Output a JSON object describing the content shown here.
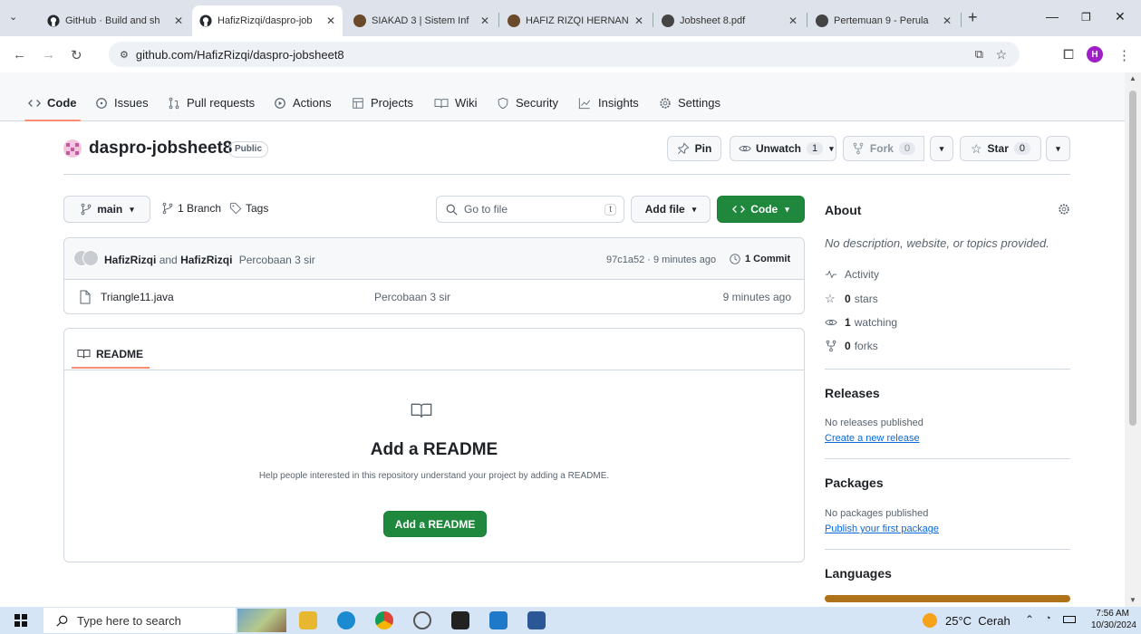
{
  "browser": {
    "tabs": [
      {
        "title": "GitHub · Build and sh",
        "icon": "github-icon"
      },
      {
        "title": "HafizRizqi/daspro-job",
        "icon": "github-icon",
        "active": true
      },
      {
        "title": "SIAKAD 3 | Sistem Inf",
        "icon": "polinema-icon"
      },
      {
        "title": "HAFIZ RIZQI HERNAN",
        "icon": "polinema-icon"
      },
      {
        "title": "Jobsheet 8.pdf",
        "icon": "globe-icon"
      },
      {
        "title": "Pertemuan 9 - Perula",
        "icon": "globe-icon"
      }
    ],
    "new_tab": "+",
    "url": "github.com/HafizRizqi/daspro-jobsheet8",
    "profile_initial": "H"
  },
  "repo_nav": {
    "tabs": [
      "Code",
      "Issues",
      "Pull requests",
      "Actions",
      "Projects",
      "Wiki",
      "Security",
      "Insights",
      "Settings"
    ]
  },
  "repo": {
    "name": "daspro-jobsheet8",
    "visibility": "Public",
    "pin_label": "Pin",
    "unwatch_label": "Unwatch",
    "watch_count": "1",
    "fork_label": "Fork",
    "fork_count": "0",
    "star_label": "Star",
    "star_count": "0"
  },
  "toolbar": {
    "branch": "main",
    "branch_count": "1 Branch",
    "tags": "Tags",
    "search_placeholder": "Go to file",
    "search_key": "t",
    "add_file": "Add file",
    "code": "Code"
  },
  "commit": {
    "author1": "HafizRizqi",
    "and": "and",
    "author2": "HafizRizqi",
    "message": "Percobaan 3 sir",
    "hash_time": "97c1a52 · 9 minutes ago",
    "commits": "1 Commit"
  },
  "files": [
    {
      "name": "Triangle11.java",
      "message": "Percobaan 3 sir",
      "time": "9 minutes ago"
    }
  ],
  "readme": {
    "tab": "README",
    "title": "Add a README",
    "description": "Help people interested in this repository understand your project by adding a README.",
    "button": "Add a README"
  },
  "about": {
    "heading": "About",
    "description": "No description, website, or topics provided.",
    "activity": "Activity",
    "stars_count": "0",
    "stars": "stars",
    "watching_count": "1",
    "watching": "watching",
    "forks_count": "0",
    "forks": "forks"
  },
  "releases": {
    "heading": "Releases",
    "text": "No releases published",
    "link": "Create a new release"
  },
  "packages": {
    "heading": "Packages",
    "text": "No packages published",
    "link": "Publish your first package"
  },
  "languages": {
    "heading": "Languages",
    "bar_color": "#b07219"
  },
  "taskbar": {
    "search_placeholder": "Type here to search",
    "weather": "25°C  Cerah",
    "time": "7:56 AM",
    "date": "10/30/2024"
  },
  "colors": {
    "accent_green": "#1f883d",
    "link_blue": "#0969da",
    "tab_underline": "#fd8c73"
  }
}
